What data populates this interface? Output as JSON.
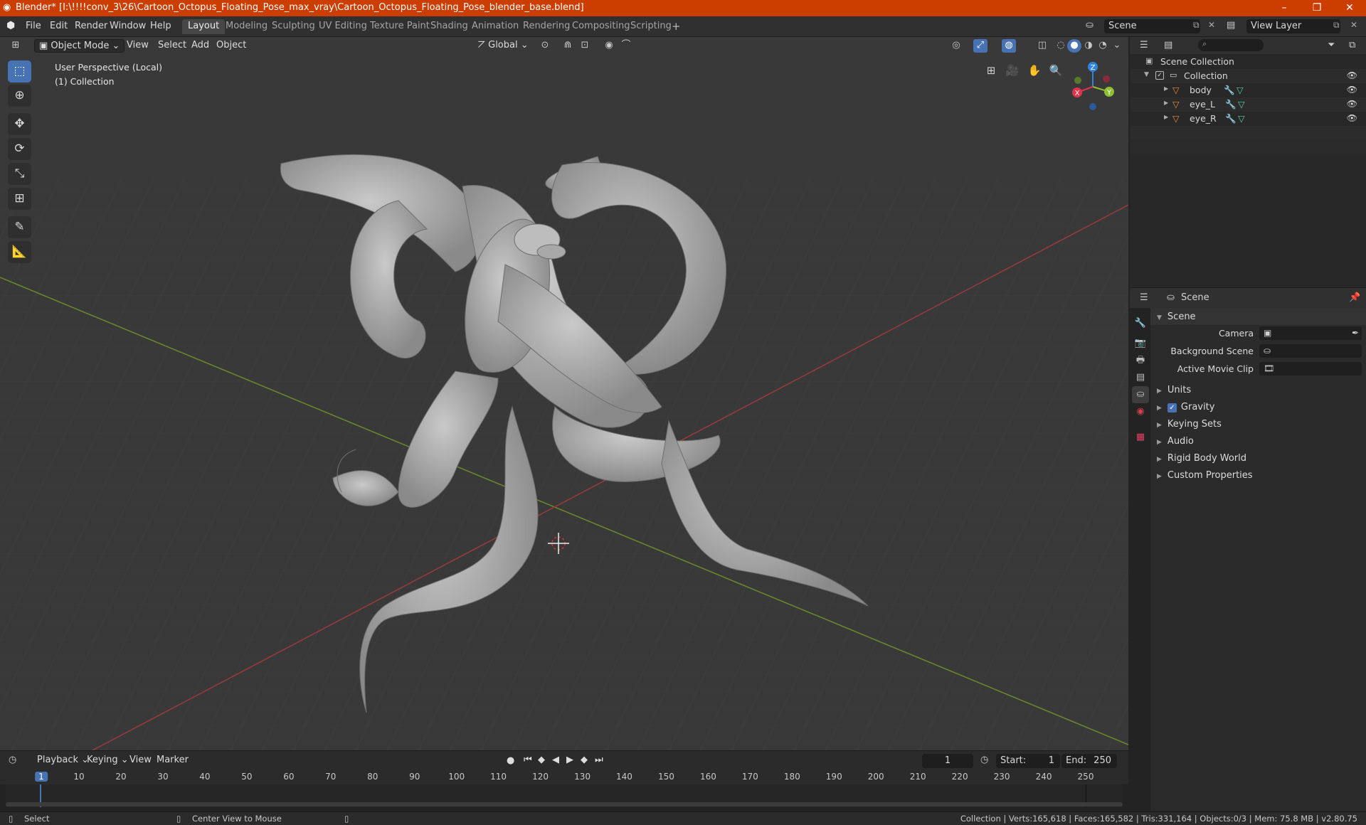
{
  "window": {
    "title": "Blender* [I:\\!!!!conv_3\\26\\Cartoon_Octopus_Floating_Pose_max_vray\\Cartoon_Octopus_Floating_Pose_blender_base.blend]",
    "min": "–",
    "max": "❐",
    "close": "✕"
  },
  "menu": [
    "File",
    "Edit",
    "Render",
    "Window",
    "Help"
  ],
  "workspaces": [
    "Layout",
    "Modeling",
    "Sculpting",
    "UV Editing",
    "Texture Paint",
    "Shading",
    "Animation",
    "Rendering",
    "Compositing",
    "Scripting"
  ],
  "scene_field": "Scene",
  "view_layer_field": "View Layer",
  "viewport": {
    "mode": "Object Mode",
    "menus": [
      "View",
      "Select",
      "Add",
      "Object"
    ],
    "transform_orientation": "Global",
    "perspective_label": "User Perspective (Local)",
    "collection_label": "(1) Collection",
    "gizmo": {
      "x": "X",
      "y": "Y",
      "z": "Z"
    }
  },
  "outliner": {
    "root": "Scene Collection",
    "collection": "Collection",
    "objects": [
      "body",
      "eye_L",
      "eye_R"
    ]
  },
  "properties": {
    "context": "Scene",
    "panel": "Scene",
    "fields": [
      {
        "label": "Camera",
        "value": ""
      },
      {
        "label": "Background Scene",
        "value": ""
      },
      {
        "label": "Active Movie Clip",
        "value": ""
      }
    ],
    "sections": [
      "Units",
      "Gravity",
      "Keying Sets",
      "Audio",
      "Rigid Body World",
      "Custom Properties"
    ],
    "gravity_checked": true
  },
  "timeline": {
    "menus": [
      "Playback",
      "Keying",
      "View",
      "Marker"
    ],
    "current_frame": "1",
    "start_label": "Start:",
    "start": "1",
    "end_label": "End:",
    "end": "250",
    "ticks": [
      "1",
      "10",
      "20",
      "30",
      "40",
      "50",
      "60",
      "70",
      "80",
      "90",
      "100",
      "110",
      "120",
      "130",
      "140",
      "150",
      "160",
      "170",
      "180",
      "190",
      "200",
      "210",
      "220",
      "230",
      "240",
      "250"
    ]
  },
  "status": {
    "left": "Select",
    "middle": "Center View to Mouse",
    "right": "Collection | Verts:165,618 | Faces:165,582 | Tris:331,164 | Objects:0/3 | Mem: 75.8 MB | v2.80.75"
  },
  "colors": {
    "accent": "#4772b3",
    "titlebar": "#cc3d00",
    "x_axis": "#e0344d",
    "y_axis": "#8fbf32",
    "z_axis": "#2f84e0"
  }
}
